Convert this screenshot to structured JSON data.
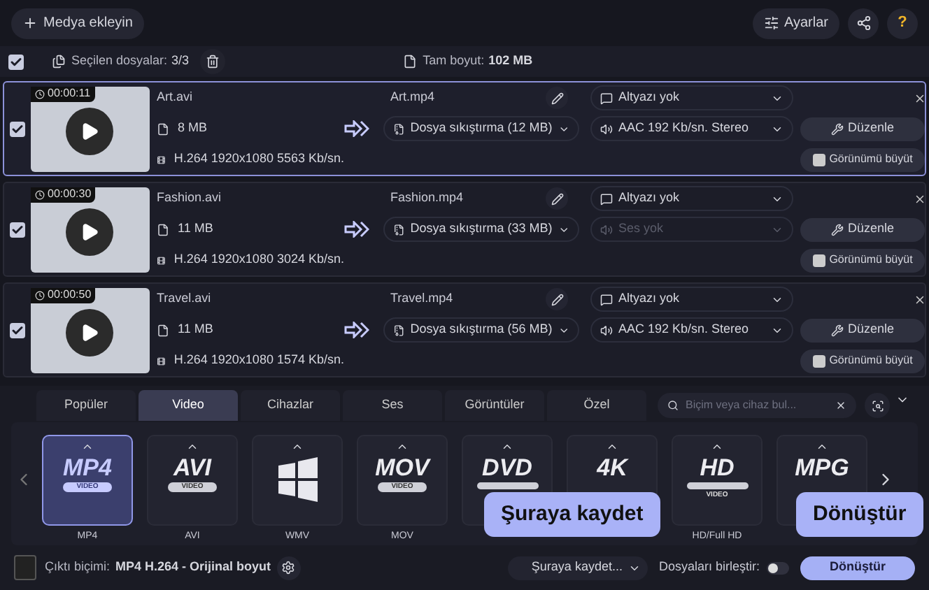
{
  "toolbar": {
    "add_media": "Medya ekleyin",
    "settings": "Ayarlar",
    "help": "?"
  },
  "selection_bar": {
    "checked": true,
    "selected_label": "Seçilen dosyalar:",
    "selected_count": "3/3",
    "total_label": "Tam boyut:",
    "total_value": "102 MB"
  },
  "files": [
    {
      "checked": true,
      "selected": true,
      "duration": "00:00:11",
      "input_name": "Art.avi",
      "size": "8 MB",
      "codec": "H.264 1920x1080 5563 Kb/sn.",
      "output_name": "Art.mp4",
      "compression": "Dosya sıkıştırma (12 MB)",
      "subtitle": "Altyazı yok",
      "audio": "AAC 192 Kb/sn. Stereo",
      "audio_disabled": false,
      "edit": "Düzenle",
      "upscale": "Görünümü büyüt"
    },
    {
      "checked": true,
      "selected": false,
      "duration": "00:00:30",
      "input_name": "Fashion.avi",
      "size": "11 MB",
      "codec": "H.264 1920x1080 3024 Kb/sn.",
      "output_name": "Fashion.mp4",
      "compression": "Dosya sıkıştırma (33 MB)",
      "subtitle": "Altyazı yok",
      "audio": "Ses yok",
      "audio_disabled": true,
      "edit": "Düzenle",
      "upscale": "Görünümü büyüt"
    },
    {
      "checked": true,
      "selected": false,
      "duration": "00:00:50",
      "input_name": "Travel.avi",
      "size": "11 MB",
      "codec": "H.264 1920x1080 1574 Kb/sn.",
      "output_name": "Travel.mp4",
      "compression": "Dosya sıkıştırma (56 MB)",
      "subtitle": "Altyazı yok",
      "audio": "AAC 192 Kb/sn. Stereo",
      "audio_disabled": false,
      "edit": "Düzenle",
      "upscale": "Görünümü büyüt"
    }
  ],
  "format_tabs": [
    {
      "label": "Popüler",
      "selected": false
    },
    {
      "label": "Video",
      "selected": true
    },
    {
      "label": "Cihazlar",
      "selected": false
    },
    {
      "label": "Ses",
      "selected": false
    },
    {
      "label": "Görüntüler",
      "selected": false
    },
    {
      "label": "Özel",
      "selected": false
    }
  ],
  "format_search": {
    "placeholder": "Biçim veya cihaz bul..."
  },
  "formats": [
    {
      "kind": "text",
      "logo": "MP4",
      "sub": "VIDEO",
      "label": "MP4",
      "selected": true
    },
    {
      "kind": "text",
      "logo": "AVI",
      "sub": "VIDEO",
      "label": "AVI",
      "selected": false
    },
    {
      "kind": "windows",
      "label": "WMV",
      "selected": false
    },
    {
      "kind": "text",
      "logo": "MOV",
      "sub": "VIDEO",
      "label": "MOV",
      "selected": false
    },
    {
      "kind": "disc",
      "logo": "DVD",
      "selected": false
    },
    {
      "kind": "text",
      "logo": "4K",
      "selected": false
    },
    {
      "kind": "disc",
      "logo": "HD",
      "sub": "VIDEO",
      "label": "HD/Full HD",
      "selected": false
    },
    {
      "kind": "text",
      "logo": "MPG",
      "selected": false
    }
  ],
  "bottom_bar": {
    "output_label": "Çıktı biçimi:",
    "output_value": "MP4 H.264 - Orijinal boyut",
    "save_to": "Şuraya kaydet...",
    "merge_label": "Dosyaları birleştir:",
    "merge_on": false,
    "convert": "Dönüştür"
  },
  "tooltips": [
    {
      "text": "Şuraya kaydet"
    },
    {
      "text": "Dönüştür"
    }
  ]
}
